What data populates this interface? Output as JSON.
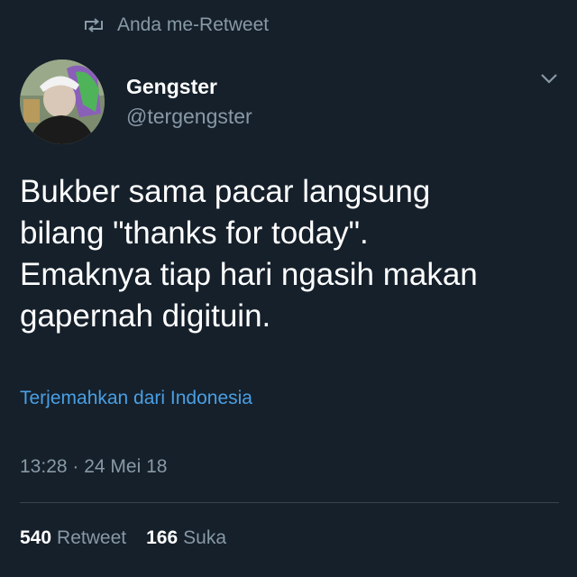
{
  "retweet_banner": {
    "icon": "retweet-icon",
    "text": "Anda me-Retweet"
  },
  "author": {
    "display_name": "Gengster",
    "handle": "@tergengster",
    "avatar": "avatar-photo"
  },
  "tweet": {
    "lines": [
      "Bukber sama pacar langsung",
      "bilang \"thanks for today\".",
      "Emaknya tiap hari ngasih makan",
      "gapernah digituin."
    ],
    "translate_link": "Terjemahkan dari Indonesia",
    "timestamp": "13:28 · 24 Mei 18"
  },
  "stats": {
    "retweets": {
      "count": "540",
      "label": "Retweet"
    },
    "likes": {
      "count": "166",
      "label": "Suka"
    }
  },
  "colors": {
    "background": "#15202b",
    "muted_text": "#8899a6",
    "link": "#4a9fe3",
    "divider": "#38444d"
  }
}
